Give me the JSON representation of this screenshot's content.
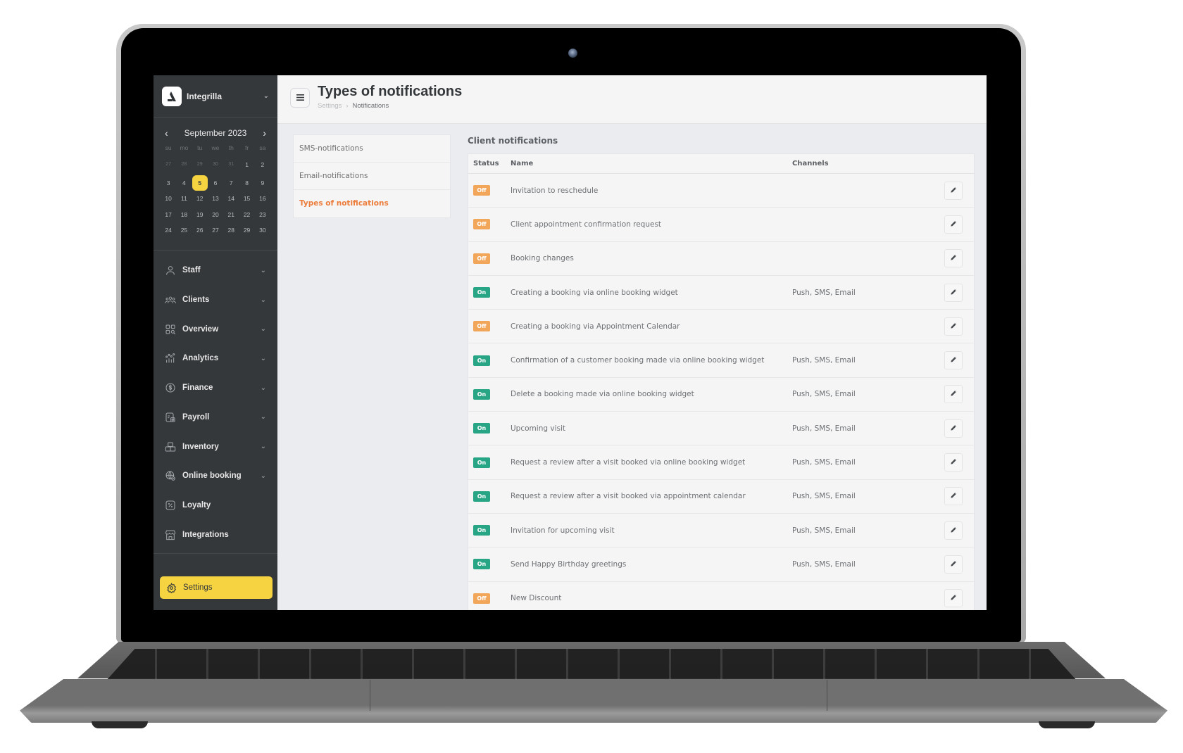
{
  "app": {
    "brand_name": "Integrilla"
  },
  "calendar": {
    "month_label": "September 2023",
    "weekdays": [
      "su",
      "mo",
      "tu",
      "we",
      "th",
      "fr",
      "sa"
    ],
    "weeks": [
      [
        "27",
        "28",
        "29",
        "30",
        "31",
        "1",
        "2"
      ],
      [
        "3",
        "4",
        "5",
        "6",
        "7",
        "8",
        "9"
      ],
      [
        "10",
        "11",
        "12",
        "13",
        "14",
        "15",
        "16"
      ],
      [
        "17",
        "18",
        "19",
        "20",
        "21",
        "22",
        "23"
      ],
      [
        "24",
        "25",
        "26",
        "27",
        "28",
        "29",
        "30"
      ]
    ],
    "selected_day": "5"
  },
  "sidebar": {
    "items": [
      {
        "label": "Staff",
        "icon": "user-icon",
        "expandable": true
      },
      {
        "label": "Clients",
        "icon": "users-icon",
        "expandable": true
      },
      {
        "label": "Overview",
        "icon": "overview-icon",
        "expandable": true
      },
      {
        "label": "Analytics",
        "icon": "analytics-icon",
        "expandable": true
      },
      {
        "label": "Finance",
        "icon": "dollar-icon",
        "expandable": true
      },
      {
        "label": "Payroll",
        "icon": "payroll-icon",
        "expandable": true
      },
      {
        "label": "Inventory",
        "icon": "boxes-icon",
        "expandable": true
      },
      {
        "label": "Online booking",
        "icon": "globe-icon",
        "expandable": true
      },
      {
        "label": "Loyalty",
        "icon": "percent-icon",
        "expandable": false
      },
      {
        "label": "Integrations",
        "icon": "store-icon",
        "expandable": false
      }
    ],
    "settings_label": "Settings"
  },
  "header": {
    "title": "Types of notifications",
    "breadcrumb": [
      "Settings",
      "Notifications"
    ]
  },
  "subnav": {
    "items": [
      {
        "label": "SMS-notifications",
        "active": false
      },
      {
        "label": "Email-notifications",
        "active": false
      },
      {
        "label": "Types of notifications",
        "active": true
      }
    ]
  },
  "notifications": {
    "section_title": "Client notifications",
    "columns": {
      "status": "Status",
      "name": "Name",
      "channels": "Channels"
    },
    "rows": [
      {
        "status": "Off",
        "name": "Invitation to reschedule",
        "channels": ""
      },
      {
        "status": "Off",
        "name": "Client appointment confirmation request",
        "channels": ""
      },
      {
        "status": "Off",
        "name": "Booking changes",
        "channels": ""
      },
      {
        "status": "On",
        "name": "Creating a booking via online booking widget",
        "channels": "Push, SMS, Email"
      },
      {
        "status": "Off",
        "name": "Creating a booking via Appointment Calendar",
        "channels": ""
      },
      {
        "status": "On",
        "name": "Confirmation of a customer booking made via online booking widget",
        "channels": "Push, SMS, Email"
      },
      {
        "status": "On",
        "name": "Delete a booking made via online booking widget",
        "channels": "Push, SMS, Email"
      },
      {
        "status": "On",
        "name": "Upcoming visit",
        "channels": "Push, SMS, Email"
      },
      {
        "status": "On",
        "name": "Request a review after a visit booked via online booking widget",
        "channels": "Push, SMS, Email"
      },
      {
        "status": "On",
        "name": "Request a review after a visit booked via appointment calendar",
        "channels": "Push, SMS, Email"
      },
      {
        "status": "On",
        "name": "Invitation for upcoming visit",
        "channels": "Push, SMS, Email"
      },
      {
        "status": "On",
        "name": "Send Happy Birthday greetings",
        "channels": "Push, SMS, Email"
      },
      {
        "status": "Off",
        "name": "New Discount",
        "channels": ""
      }
    ]
  },
  "colors": {
    "sidebar_bg": "#35383b",
    "accent_yellow": "#f5d341",
    "active_orange": "#ec7c3a",
    "status_on": "#27a585",
    "status_off": "#f2a65a"
  }
}
